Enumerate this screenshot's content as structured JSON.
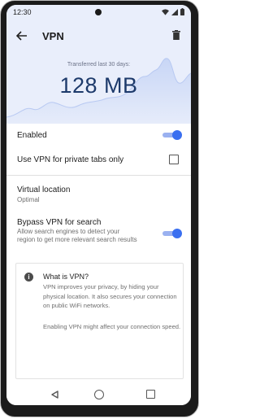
{
  "status_bar": {
    "time": "12:30"
  },
  "header": {
    "title": "VPN",
    "transfer_caption": "Transferred last 30 days:",
    "transfer_amount": "128 MB"
  },
  "settings": {
    "enabled_label": "Enabled",
    "enabled_on": true,
    "private_tabs_label": "Use VPN for private tabs only",
    "private_tabs_checked": false,
    "location_label": "Virtual location",
    "location_value": "Optimal",
    "bypass_label": "Bypass VPN for search",
    "bypass_desc_line1": "Allow search engines to detect your",
    "bypass_desc_line2": "region to get more relevant search results",
    "bypass_on": true
  },
  "info": {
    "title": "What is VPN?",
    "body": "VPN improves your privacy, by hiding your physical location. It also secures your connection on public WiFi networks.",
    "note": "Enabling VPN might affect your connection speed."
  },
  "colors": {
    "header_bg": "#e9eefb",
    "accent": "#3a6ff0",
    "amount": "#1d3a6b"
  }
}
